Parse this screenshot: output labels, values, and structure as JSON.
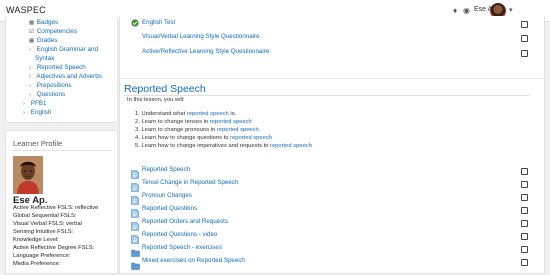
{
  "header": {
    "brand": "WASPEC",
    "user_name": "Ese Ap.",
    "icons": [
      "bell-icon",
      "chat-icon",
      "user-avatar",
      "caret-down-icon"
    ]
  },
  "nav": {
    "items": [
      {
        "label": "Badges",
        "icon": "badge-icon"
      },
      {
        "label": "Competencies",
        "icon": "check-square-icon"
      },
      {
        "label": "Grades",
        "icon": "table-icon"
      },
      {
        "label": "English Grammar and",
        "icon": "chevron-right-icon"
      },
      {
        "label": "Syntax",
        "icon": ""
      },
      {
        "label": "Reported Speech",
        "icon": "chevron-right-icon"
      },
      {
        "label": "Adjectives and Adverbs",
        "icon": "chevron-right-icon"
      },
      {
        "label": "Prepositions",
        "icon": "chevron-right-icon"
      },
      {
        "label": "Questions",
        "icon": "chevron-right-icon"
      },
      {
        "label": "PFB1",
        "icon": "chevron-right-icon"
      },
      {
        "label": "English",
        "icon": "chevron-right-icon"
      }
    ]
  },
  "learner_profile": {
    "title": "Learner Profile",
    "name": "Ese Ap.",
    "rows": [
      "Active Reflective FSLS: reflective",
      "Global Sequential FSLS:",
      "Visual Verbal FSLS: verbal",
      "Sensing Intuitive FSLS:",
      "Knowledge Level:",
      "Active Reflective Degree FSLS:",
      "Language Preference:",
      "Media Preference:"
    ]
  },
  "main": {
    "top_activities": [
      {
        "label": "English Test",
        "icon": "quiz-icon"
      },
      {
        "label": "Visual/Verbal Learning Style Questionnaire",
        "icon": ""
      },
      {
        "label": "Active/Reflective Learning Style Questionnaire",
        "icon": ""
      }
    ],
    "section_title": "Reported Speech",
    "intro": "In this lesson, you will:",
    "objectives": [
      {
        "pre": "1. Understand what ",
        "link": "reported speech",
        "post": " is."
      },
      {
        "pre": "2. Learn to change tenses in ",
        "link": "reported speech",
        "post": ""
      },
      {
        "pre": "3. Learn to change pronouns in ",
        "link": "reported speech",
        "post": ""
      },
      {
        "pre": "4. Learn how to change questions to ",
        "link": "reported speech",
        "post": ""
      },
      {
        "pre": "5. Learn how to change imperatives and requests to ",
        "link": "reported speech",
        "post": ""
      }
    ],
    "activities": [
      {
        "label": "Reported Speech",
        "icon": "page-icon"
      },
      {
        "label": "Tense Change in Reported Speech",
        "icon": "page-icon"
      },
      {
        "label": "Pronoun Changes",
        "icon": "page-icon"
      },
      {
        "label": "Reported Questions",
        "icon": "page-icon"
      },
      {
        "label": "Reported Orders and Requests",
        "icon": "page-icon"
      },
      {
        "label": "Reported Questions - video",
        "icon": "page-icon"
      },
      {
        "label": "Reported Speech - exercises",
        "icon": "folder-icon"
      },
      {
        "label": "Mixed exercises on Reported Speech",
        "icon": "folder-icon"
      }
    ]
  },
  "colors": {
    "link": "#0f6cbf",
    "background": "#f0f0f0"
  }
}
